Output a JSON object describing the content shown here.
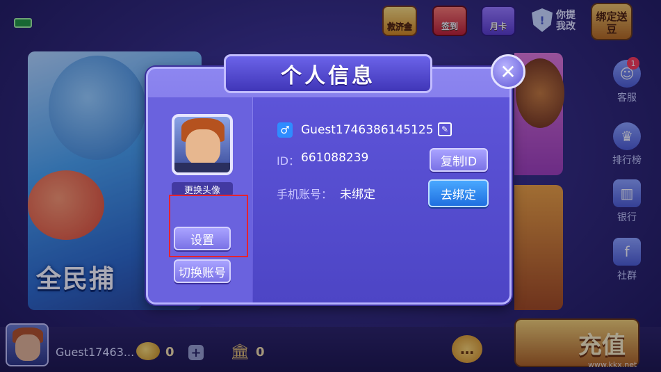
{
  "topbar": {
    "icons": [
      {
        "label": "救济金",
        "icon": "treasure-chest-icon"
      },
      {
        "label": "签到",
        "icon": "calendar-icon"
      },
      {
        "label": "月卡",
        "icon": "month-card-icon"
      }
    ],
    "tip_label": "你提我改",
    "bind_beans_label": "绑定送豆"
  },
  "background": {
    "game_title": "全民捕"
  },
  "sidebar": {
    "items": [
      {
        "label": "客服",
        "badge": "1",
        "icon": "customer-service-icon"
      },
      {
        "label": "排行榜",
        "icon": "trophy-icon"
      },
      {
        "label": "银行",
        "icon": "bank-icon"
      },
      {
        "label": "社群",
        "icon": "facebook-icon",
        "glyph": "f"
      }
    ]
  },
  "bottom": {
    "username": "Guest17463...",
    "beans": "0",
    "bank": "0",
    "recharge_label": "充值",
    "watermark": "www.kkx.net"
  },
  "dialog": {
    "title": "个人信息",
    "change_avatar": "更换头像",
    "settings_button": "设置",
    "switch_account_button": "切换账号",
    "gender_symbol": "♂",
    "username": "Guest1746386145125",
    "id_label": "ID：",
    "id_value": "661088239",
    "copy_id_button": "复制ID",
    "phone_label": "手机账号：",
    "phone_value": "未绑定",
    "bind_button": "去绑定"
  },
  "colors": {
    "accent_blue": "#1f6fe0",
    "highlight_red": "#e5232f",
    "dialog_purple": "#5f55d4"
  }
}
